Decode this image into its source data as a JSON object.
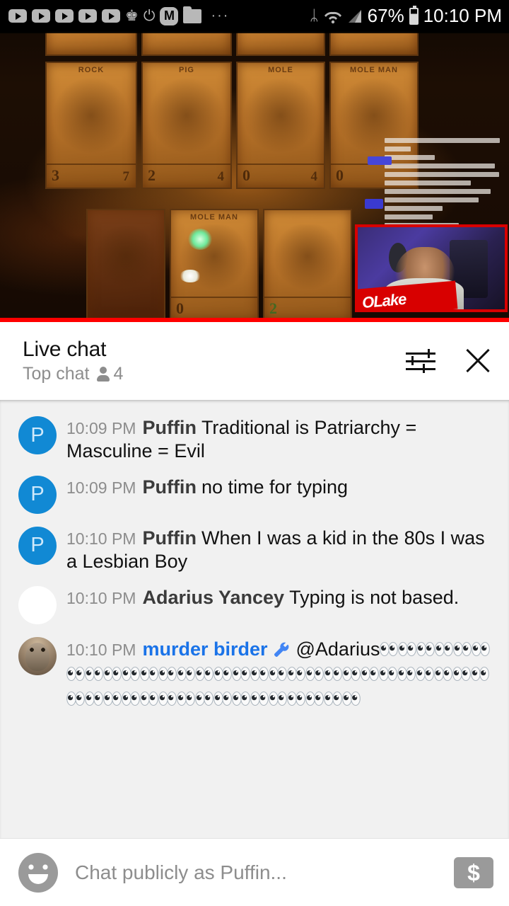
{
  "status_bar": {
    "notification_icons": [
      {
        "name": "youtube-icon"
      },
      {
        "name": "youtube-icon"
      },
      {
        "name": "youtube-icon"
      },
      {
        "name": "youtube-icon"
      },
      {
        "name": "youtube-icon"
      },
      {
        "name": "crown-icon",
        "glyph": "♚"
      },
      {
        "name": "power-timer-icon",
        "glyph": "⏻"
      },
      {
        "name": "m-badge-icon",
        "label": "M"
      },
      {
        "name": "folder-icon"
      }
    ],
    "overflow_dots": "···",
    "bluetooth_glyph": "ᛦ",
    "wifi_glyph": "◠",
    "signal_glyph": "◢",
    "battery_percent": "67%",
    "time": "10:10 PM"
  },
  "video": {
    "cards": [
      {
        "caption": "ROCK",
        "num": "3",
        "num2": "7"
      },
      {
        "caption": "PIG",
        "num": "2",
        "num2": "4"
      },
      {
        "caption": "MOLE",
        "num": "0",
        "num2": "4"
      },
      {
        "caption": "MOLE MAN",
        "num": "0",
        "num2": ""
      }
    ],
    "cards_bottom": [
      {
        "caption": "",
        "num": "",
        "num2": ""
      },
      {
        "caption": "MOLE MAN",
        "num": "0",
        "num2": ""
      },
      {
        "caption": "",
        "num": "2",
        "num2": ""
      }
    ],
    "webcam_banner": "OLake"
  },
  "chat_header": {
    "title": "Live chat",
    "mode": "Top chat",
    "viewer_count": "4",
    "settings_icon": "tune-icon",
    "close_icon": "close-icon"
  },
  "messages": [
    {
      "avatar_type": "letter",
      "avatar_letter": "P",
      "timestamp": "10:09 PM",
      "author": "Puffin",
      "is_moderator": false,
      "text": "Traditional is Patriarchy = Masculine = Evil"
    },
    {
      "avatar_type": "letter",
      "avatar_letter": "P",
      "timestamp": "10:09 PM",
      "author": "Puffin",
      "is_moderator": false,
      "text": "no time for typing"
    },
    {
      "avatar_type": "letter",
      "avatar_letter": "P",
      "timestamp": "10:10 PM",
      "author": "Puffin",
      "is_moderator": false,
      "text": "When I was a kid in the 80s I was a Lesbian Boy"
    },
    {
      "avatar_type": "blank",
      "avatar_letter": "",
      "timestamp": "10:10 PM",
      "author": "Adarius Yancey",
      "is_moderator": false,
      "text": "Typing is not based."
    },
    {
      "avatar_type": "owl",
      "avatar_letter": "",
      "timestamp": "10:10 PM",
      "author": "murder birder",
      "is_moderator": true,
      "badge_icon": "wrench-icon",
      "mention": "@Adarius",
      "emoji_name": "eyes-emoji",
      "emoji_count": 45
    }
  ],
  "composer": {
    "emoji_button_icon": "emoji-face-icon",
    "placeholder": "Chat publicly as Puffin...",
    "superchat_icon": "dollar-icon",
    "superchat_glyph": "$"
  },
  "colors": {
    "avatar_blue": "#1189d4",
    "moderator_blue": "#1a73e8",
    "message_bg": "#f1f1f1",
    "progress_red": "#ff0000"
  }
}
